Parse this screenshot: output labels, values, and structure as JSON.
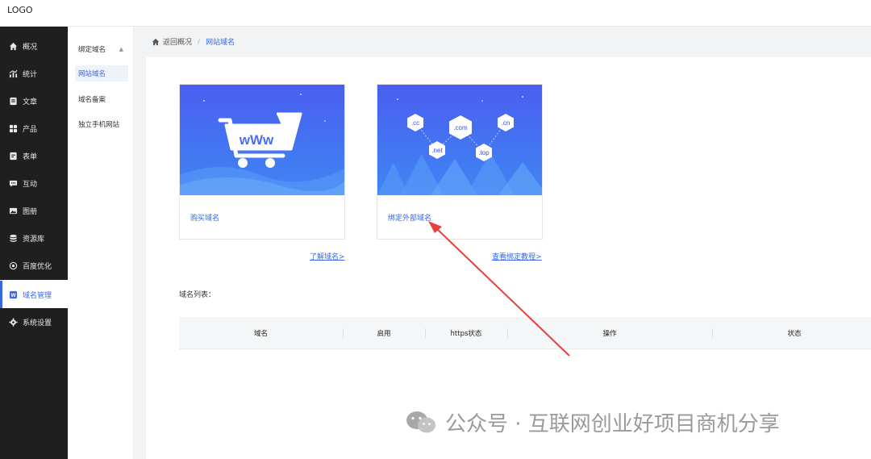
{
  "topbar": {
    "logo": "LOGO"
  },
  "sidebar": {
    "items": [
      {
        "label": "概况",
        "icon": "home-icon"
      },
      {
        "label": "统计",
        "icon": "stats-icon"
      },
      {
        "label": "文章",
        "icon": "article-icon"
      },
      {
        "label": "产品",
        "icon": "product-icon"
      },
      {
        "label": "表单",
        "icon": "form-icon"
      },
      {
        "label": "互动",
        "icon": "chat-icon"
      },
      {
        "label": "图册",
        "icon": "gallery-icon"
      },
      {
        "label": "资源库",
        "icon": "database-icon"
      },
      {
        "label": "百度优化",
        "icon": "seo-icon"
      },
      {
        "label": "域名管理",
        "icon": "domain-icon",
        "active": true
      },
      {
        "label": "系统设置",
        "icon": "gear-icon"
      }
    ]
  },
  "subnav": {
    "header": "绑定域名",
    "items": [
      {
        "label": "网站域名",
        "selected": true
      },
      {
        "label": "域名备案"
      },
      {
        "label": "独立手机网站"
      }
    ]
  },
  "breadcrumb": {
    "back": "返回概况",
    "current": "网站域名"
  },
  "cards": {
    "buy": {
      "label": "购买域名",
      "art_text": "wWw",
      "link": "了解域名>"
    },
    "bind": {
      "label": "绑定外部域名",
      "link": "查看绑定教程>",
      "badges": [
        ".cc",
        ".com",
        ".cn",
        ".net",
        ".top"
      ]
    }
  },
  "domain_list": {
    "title": "域名列表：",
    "columns": [
      "域名",
      "启用",
      "https状态",
      "操作",
      "状态"
    ]
  },
  "watermark": {
    "text": "公众号 · 互联网创业好项目商机分享"
  },
  "colors": {
    "accent": "#3a66e6",
    "sidebar_bg": "#1f1f1f",
    "annotation": "#e8403a"
  }
}
